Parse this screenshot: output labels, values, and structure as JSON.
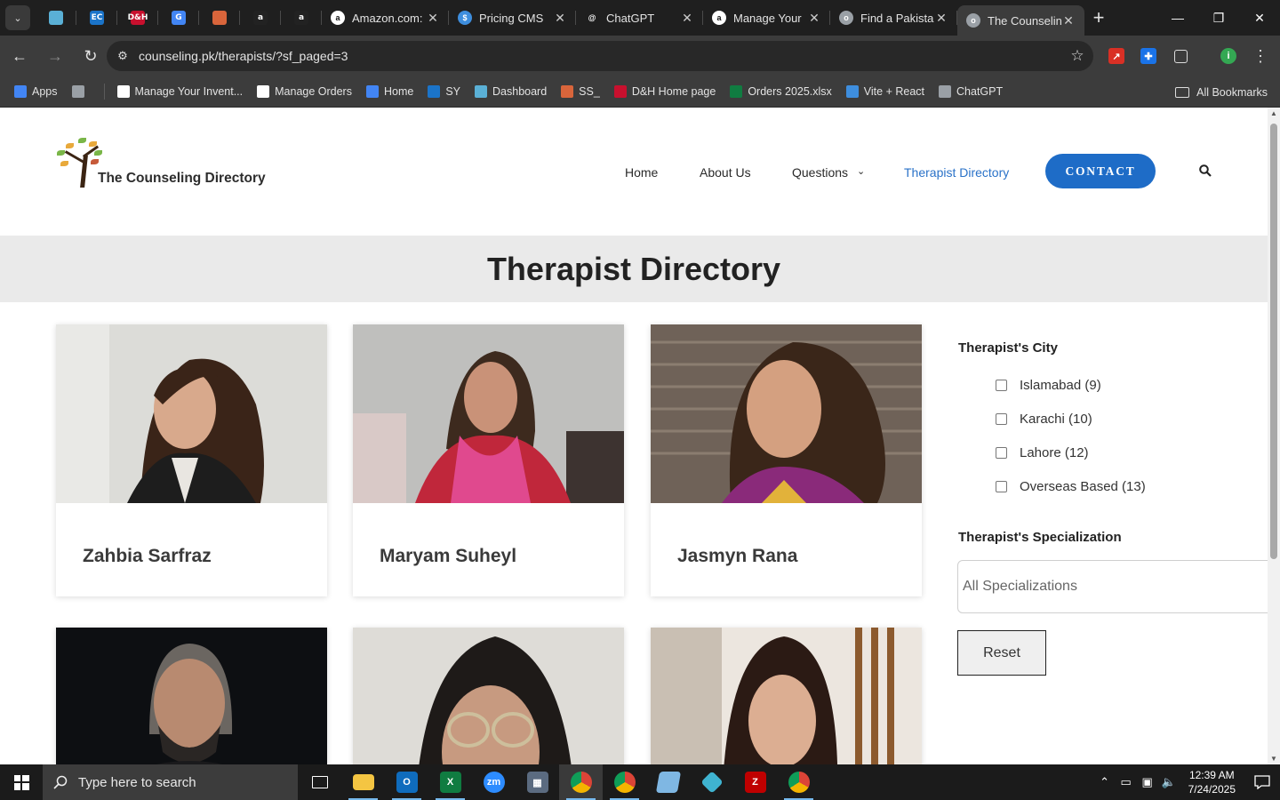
{
  "browser": {
    "pinned_tabs": [
      {
        "icon": "kite-icon",
        "label": "",
        "color": "#5ab0d6"
      },
      {
        "icon": "ec-icon",
        "label": "EC",
        "color": "#1b74c9"
      },
      {
        "icon": "dh-icon",
        "label": "D&H",
        "color": "#c8102e"
      },
      {
        "icon": "g-icon",
        "label": "G",
        "color": "#4285f4"
      },
      {
        "icon": "stack-icon",
        "label": "",
        "color": "#d9653b"
      },
      {
        "icon": "amazon-icon",
        "label": "a",
        "color": "#222222"
      },
      {
        "icon": "amazon-icon",
        "label": "a",
        "color": "#222222"
      }
    ],
    "tabs": [
      {
        "title": "Amazon.com:",
        "favicon": "a",
        "color": "#ffffff",
        "active": false
      },
      {
        "title": "Pricing CMS",
        "favicon": "$",
        "color": "#3e8ede",
        "active": false
      },
      {
        "title": "ChatGPT",
        "favicon": "@",
        "color": "#1f1f1f",
        "active": false
      },
      {
        "title": "Manage Your",
        "favicon": "a",
        "color": "#ffffff",
        "active": false
      },
      {
        "title": "Find a Pakista",
        "favicon": "o",
        "color": "#9aa0a6",
        "active": false
      },
      {
        "title": "The Counselin",
        "favicon": "o",
        "color": "#9aa0a6",
        "active": true
      }
    ],
    "new_tab": "+",
    "address": "counseling.pk/therapists/?sf_paged=3",
    "bookmarks": [
      {
        "label": "Apps",
        "color": "#4285f4"
      },
      {
        "label": "",
        "color": "#9aa0a6"
      },
      {
        "label": "Manage Your Invent...",
        "color": "#ffffff"
      },
      {
        "label": "Manage Orders",
        "color": "#ffffff"
      },
      {
        "label": "Home",
        "color": "#4285f4"
      },
      {
        "label": "SY",
        "color": "#1b74c9"
      },
      {
        "label": "Dashboard",
        "color": "#5ab0d6"
      },
      {
        "label": "SS_",
        "color": "#d9653b"
      },
      {
        "label": "D&H Home page",
        "color": "#c8102e"
      },
      {
        "label": "Orders 2025.xlsx",
        "color": "#107c41"
      },
      {
        "label": "Vite + React",
        "color": "#3e8ede"
      },
      {
        "label": "ChatGPT",
        "color": "#9aa0a6"
      }
    ],
    "all_bookmarks": "All Bookmarks",
    "profile_initial": "i"
  },
  "site": {
    "logo_text": "The Counseling Directory",
    "nav": {
      "home": "Home",
      "about": "About Us",
      "questions": "Questions",
      "questions_caret": "⌄",
      "directory": "Therapist Directory",
      "contact": "CONTACT"
    },
    "page_title": "Therapist Directory",
    "therapists": [
      {
        "name": "Zahbia Sarfraz"
      },
      {
        "name": "Maryam Suheyl"
      },
      {
        "name": "Jasmyn Rana"
      },
      {
        "name": ""
      },
      {
        "name": ""
      },
      {
        "name": ""
      }
    ],
    "filters": {
      "city_heading": "Therapist's City",
      "cities": [
        {
          "label": "Islamabad (9)"
        },
        {
          "label": "Karachi (10)"
        },
        {
          "label": "Lahore (12)"
        },
        {
          "label": "Overseas Based (13)"
        }
      ],
      "spec_heading": "Therapist's Specialization",
      "spec_value": "All Specializations",
      "reset": "Reset"
    },
    "colors": {
      "accent": "#1e6cc7",
      "current_nav": "#2a72c8"
    }
  },
  "taskbar": {
    "search_placeholder": "Type here to search",
    "time": "12:39 AM",
    "date": "7/24/2025"
  }
}
